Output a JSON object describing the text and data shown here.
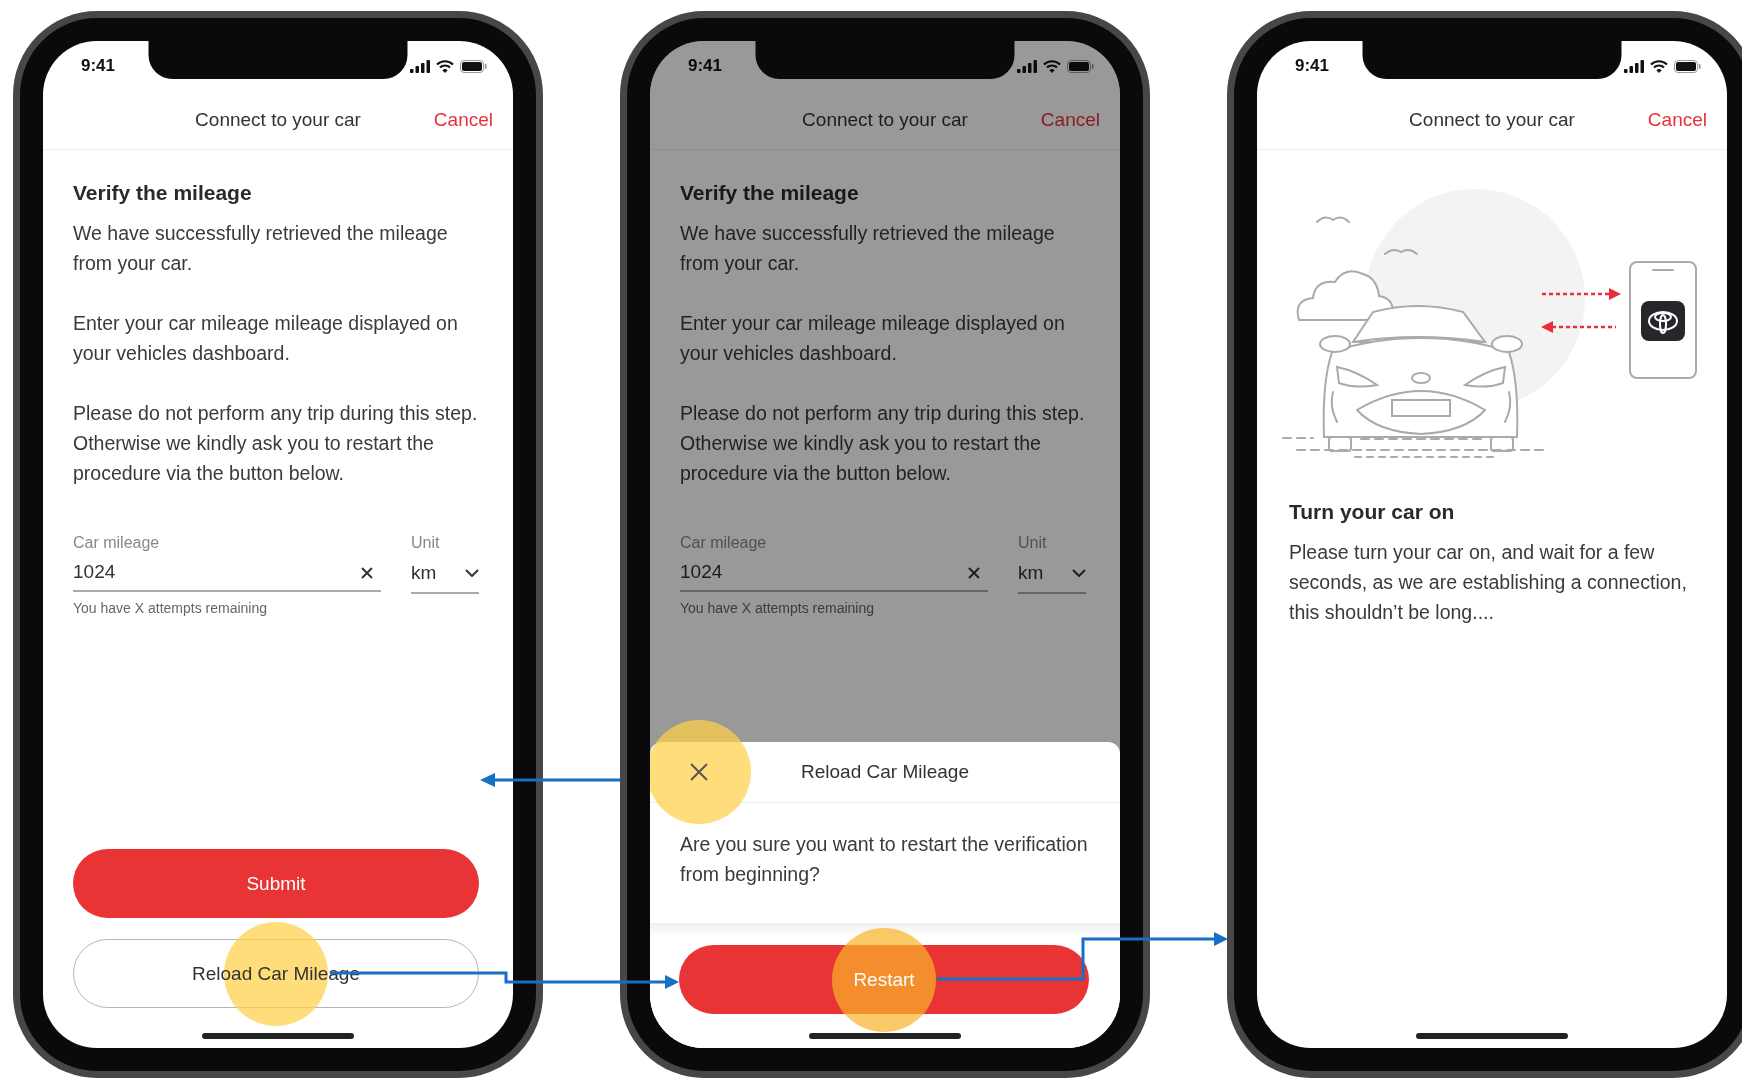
{
  "screens": [
    {
      "kind": "form",
      "dimmed": false,
      "status_bar": {
        "time": "9:41"
      },
      "header": {
        "title": "Connect to your car",
        "cancel": "Cancel"
      },
      "heading": "Verify the mileage",
      "paragraphs": [
        "We have successfully retrieved the mileage from your car.",
        "Enter your car mileage mileage displayed on your vehicles dashboard.",
        "Please do not perform any trip during this step. Otherwise we kindly ask you to restart the procedure via the button below."
      ],
      "mileage_field": {
        "label": "Car mileage",
        "value": "1024"
      },
      "unit_field": {
        "label": "Unit",
        "value": "km"
      },
      "helper": "You have X attempts remaining",
      "actions": [
        {
          "kind": "primary",
          "label": "Submit",
          "highlighted": false
        },
        {
          "kind": "secondary",
          "label": "Reload Car Mileage",
          "highlighted": true
        }
      ]
    },
    {
      "kind": "form",
      "dimmed": true,
      "status_bar": {
        "time": "9:41"
      },
      "header": {
        "title": "Connect to your car",
        "cancel": "Cancel"
      },
      "heading": "Verify the mileage",
      "paragraphs": [
        "We have successfully retrieved the mileage from your car.",
        "Enter your car mileage mileage displayed on your vehicles dashboard.",
        "Please do not perform any trip during this step. Otherwise we kindly ask you to restart the procedure via the button below."
      ],
      "mileage_field": {
        "label": "Car mileage",
        "value": "1024"
      },
      "unit_field": {
        "label": "Unit",
        "value": "km"
      },
      "helper": "You have X attempts remaining",
      "sheet": {
        "title": "Reload Car Mileage",
        "close_highlighted": true,
        "message": "Are you sure you want to restart the verification from beginning?",
        "action": {
          "label": "Restart",
          "highlighted": true
        }
      }
    },
    {
      "kind": "illustration",
      "dimmed": false,
      "status_bar": {
        "time": "9:41"
      },
      "header": {
        "title": "Connect to your car",
        "cancel": "Cancel"
      },
      "heading": "Turn your car on",
      "paragraphs": [
        "Please turn your car on, and wait for a few seconds, as we are establishing a connection, this shouldn’t be long...."
      ]
    }
  ]
}
